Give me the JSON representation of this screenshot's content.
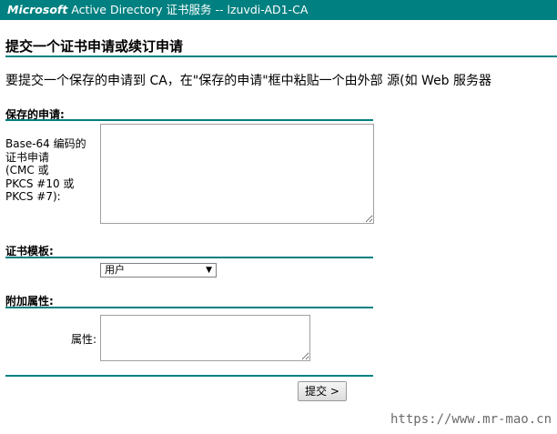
{
  "header": {
    "brand": "Microsoft",
    "title": "Active Directory 证书服务 -- lzuvdi-AD1-CA"
  },
  "page": {
    "heading": "提交一个证书申请或续订申请",
    "intro": "要提交一个保存的申请到 CA，在\"保存的申请\"框中粘贴一个由外部 源(如 Web 服务器"
  },
  "saved_request": {
    "section_title": "保存的申请:",
    "label_lines": [
      "Base-64 编码的",
      "证书申请",
      "(CMC 或",
      "PKCS #10 或",
      "PKCS #7):"
    ],
    "value": ""
  },
  "template": {
    "section_title": "证书模板:",
    "selected": "用户"
  },
  "attributes": {
    "section_title": "附加属性:",
    "label": "属性:",
    "value": ""
  },
  "actions": {
    "submit_label": "提交 >"
  },
  "watermark": "https://www.mr-mao.cn",
  "colors": {
    "accent": "#008080"
  }
}
